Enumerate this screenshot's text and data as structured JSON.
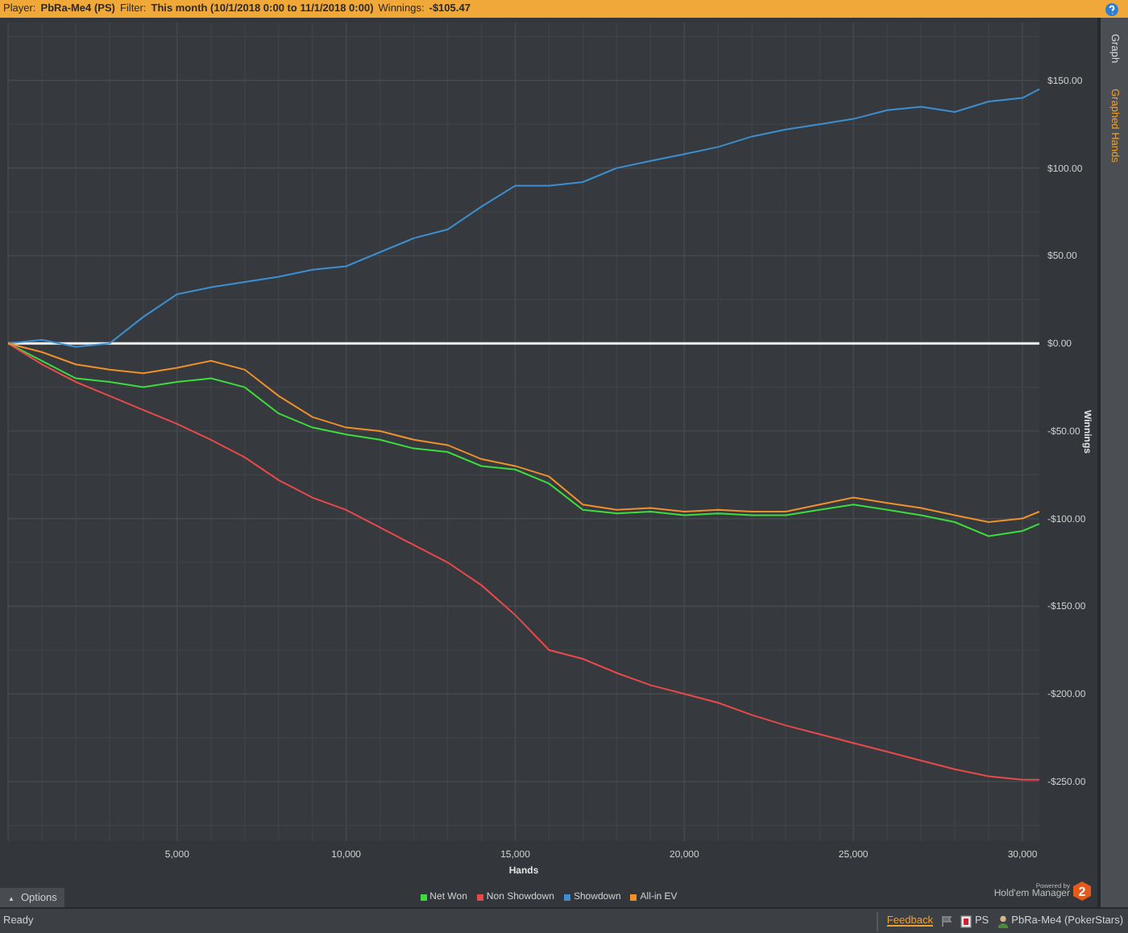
{
  "header": {
    "items": [
      {
        "label": "Player:",
        "value": "PbRa-Me4 (PS)"
      },
      {
        "label": "Filter:",
        "value": "This month (10/1/2018 0:00 to 11/1/2018 0:00)"
      },
      {
        "label": "Winnings:",
        "value": "-$105.47"
      }
    ]
  },
  "side_tabs": [
    {
      "label": "Graph",
      "selected": false
    },
    {
      "label": "Graphed Hands",
      "selected": true
    }
  ],
  "chart": {
    "chart_data": {
      "type": "line",
      "grid": true,
      "xlabel": "Hands",
      "ylabel": "Winnings",
      "xlim": [
        0,
        30500
      ],
      "ylim": [
        -284,
        183
      ],
      "xticks": [
        {
          "value": 5000,
          "label": "5,000"
        },
        {
          "value": 10000,
          "label": "10,000"
        },
        {
          "value": 15000,
          "label": "15,000"
        },
        {
          "value": 20000,
          "label": "20,000"
        },
        {
          "value": 25000,
          "label": "25,000"
        },
        {
          "value": 30000,
          "label": "30,000"
        }
      ],
      "yticks": [
        {
          "value": 150,
          "label": "$150.00"
        },
        {
          "value": 100,
          "label": "$100.00"
        },
        {
          "value": 50,
          "label": "$50.00"
        },
        {
          "value": 0,
          "label": "$0.00"
        },
        {
          "value": -50,
          "label": "-$50.00"
        },
        {
          "value": -100,
          "label": "-$100.00"
        },
        {
          "value": -150,
          "label": "-$150.00"
        },
        {
          "value": -200,
          "label": "-$200.00"
        },
        {
          "value": -250,
          "label": "-$250.00"
        }
      ],
      "x": [
        0,
        1000,
        2000,
        3000,
        4000,
        5000,
        6000,
        7000,
        8000,
        9000,
        10000,
        11000,
        12000,
        13000,
        14000,
        15000,
        16000,
        17000,
        18000,
        19000,
        20000,
        21000,
        22000,
        23000,
        24000,
        25000,
        26000,
        27000,
        28000,
        29000,
        30000,
        30500
      ],
      "series": [
        {
          "name": "Net Won",
          "color": "#3ddc3d",
          "values": [
            0,
            -10,
            -20,
            -22,
            -25,
            -22,
            -20,
            -25,
            -40,
            -48,
            -52,
            -55,
            -60,
            -62,
            -70,
            -72,
            -80,
            -95,
            -97,
            -96,
            -98,
            -97,
            -98,
            -98,
            -95,
            -92,
            -95,
            -98,
            -102,
            -110,
            -107,
            -103
          ]
        },
        {
          "name": "Non Showdown",
          "color": "#e84a4a",
          "values": [
            0,
            -12,
            -22,
            -30,
            -38,
            -46,
            -55,
            -65,
            -78,
            -88,
            -95,
            -105,
            -115,
            -125,
            -138,
            -155,
            -175,
            -180,
            -188,
            -195,
            -200,
            -205,
            -212,
            -218,
            -223,
            -228,
            -233,
            -238,
            -243,
            -247,
            -249,
            -249
          ]
        },
        {
          "name": "Showdown",
          "color": "#3d8fd0",
          "values": [
            0,
            2,
            -2,
            0,
            15,
            28,
            32,
            35,
            38,
            42,
            44,
            52,
            60,
            65,
            78,
            90,
            90,
            92,
            100,
            104,
            108,
            112,
            118,
            122,
            125,
            128,
            133,
            135,
            132,
            138,
            140,
            145
          ]
        },
        {
          "name": "All-in EV",
          "color": "#f0902a",
          "values": [
            0,
            -5,
            -12,
            -15,
            -17,
            -14,
            -10,
            -15,
            -30,
            -42,
            -48,
            -50,
            -55,
            -58,
            -66,
            -70,
            -76,
            -92,
            -95,
            -94,
            -96,
            -95,
            -96,
            -96,
            -92,
            -88,
            -91,
            -94,
            -98,
            -102,
            -100,
            -96
          ]
        }
      ]
    }
  },
  "options_tab": {
    "icon": "▲",
    "label": "Options"
  },
  "logo": {
    "caption": "Powered by",
    "name": "Hold'em Manager",
    "badge": "2"
  },
  "status_bar": {
    "status": "Ready",
    "feedback": "Feedback",
    "site": "PS",
    "player": "PbRa-Me4 (PokerStars)"
  }
}
